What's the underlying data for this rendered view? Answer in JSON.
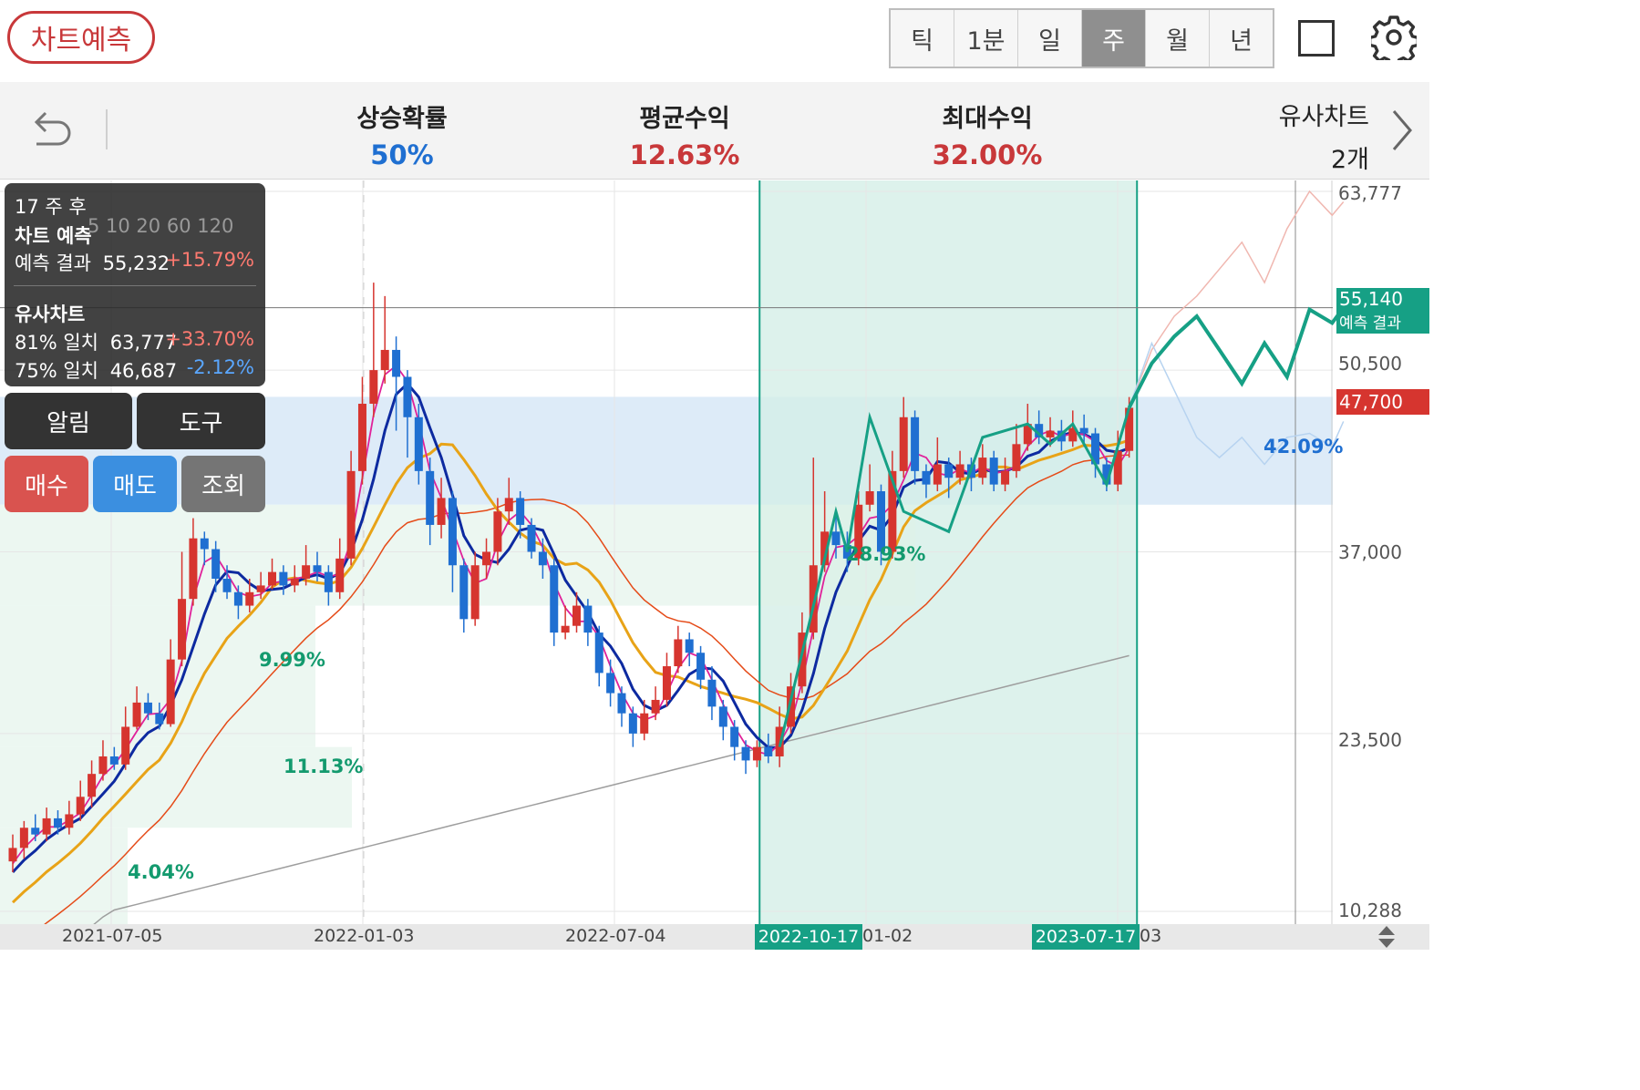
{
  "header": {
    "predict_button": "차트예측",
    "periods": [
      {
        "label": "틱",
        "selected": false
      },
      {
        "label": "1분",
        "selected": false
      },
      {
        "label": "일",
        "selected": false
      },
      {
        "label": "주",
        "selected": true
      },
      {
        "label": "월",
        "selected": false
      },
      {
        "label": "년",
        "selected": false
      }
    ],
    "icons": [
      "square-icon",
      "gear-icon"
    ]
  },
  "stats": {
    "rise_prob": {
      "label": "상승확률",
      "value": "50%"
    },
    "avg_return": {
      "label": "평균수익",
      "value": "12.63%"
    },
    "max_return": {
      "label": "최대수익",
      "value": "32.00%"
    },
    "similar": {
      "label": "유사차트",
      "value": "2개"
    }
  },
  "colors": {
    "up": "#d6352f",
    "down": "#1f6fd1",
    "accent_green": "#16a085",
    "ma5": "#e0219a",
    "ma10": "#0d2aa0",
    "ma20": "#e8a317",
    "ma60": "#e54b18",
    "ma120": "#9e9e9e"
  },
  "overlay": {
    "weeks_after": "17 주 후",
    "predict_title": "차트 예측",
    "predict_label": "예측 결과",
    "predict_value": "55,232",
    "predict_change": "+15.79%",
    "similar_title": "유사차트",
    "sim1_label": "81% 일치",
    "sim1_value": "63,777",
    "sim1_change": "+33.70%",
    "sim2_label": "75% 일치",
    "sim2_value": "46,687",
    "sim2_change": "-2.12%",
    "legend_partial": "5  10  20  60  120"
  },
  "actions": {
    "alert": "알림",
    "tools": "도구",
    "buy": "매수",
    "sell": "매도",
    "lookup": "조회"
  },
  "chart_data": {
    "type": "candlestick",
    "period": "weekly",
    "y_ticks": [
      "63,777",
      "50,500",
      "37,000",
      "23,500",
      "10,288"
    ],
    "y_tick_values": [
      63777,
      50500,
      37000,
      23500,
      10288
    ],
    "x_ticks": [
      "2021-07-05",
      "2022-01-03",
      "2022-07-04",
      "01-02",
      "03"
    ],
    "x_tick_values": [
      "2021-07-05",
      "2022-01-03",
      "2022-07-04",
      "2023-01-02",
      "2023-07-03"
    ],
    "highlight_start": "2022-10-17",
    "highlight_end": "2023-07-17",
    "current_price": "47,700",
    "current_price_value": 47700,
    "predict_label": "55,140",
    "predict_label_value": 55140,
    "predict_tag": "예측 결과",
    "zone_pct_right": "42.09%",
    "region_pcts": [
      "9.99%",
      "11.13%",
      "4.04%",
      "28.93%"
    ],
    "candles": [
      [
        0,
        14000,
        15000,
        16000,
        13200
      ],
      [
        1,
        15000,
        16500,
        17000,
        14200
      ],
      [
        2,
        16500,
        16000,
        17500,
        15500
      ],
      [
        3,
        16000,
        17200,
        18000,
        15500
      ],
      [
        4,
        17200,
        16500,
        17800,
        16000
      ],
      [
        5,
        16500,
        17500,
        18500,
        16000
      ],
      [
        6,
        17500,
        18800,
        20000,
        17000
      ],
      [
        7,
        18800,
        20500,
        21500,
        18000
      ],
      [
        8,
        20500,
        21800,
        23000,
        20000
      ],
      [
        9,
        21800,
        21200,
        22500,
        20800
      ],
      [
        10,
        21200,
        24000,
        25500,
        20800
      ],
      [
        11,
        24000,
        25800,
        27000,
        23800
      ],
      [
        12,
        25800,
        25000,
        26500,
        24500
      ],
      [
        13,
        25000,
        24200,
        25800,
        23800
      ],
      [
        14,
        24200,
        29000,
        30500,
        24000
      ],
      [
        15,
        29000,
        33500,
        37000,
        28500
      ],
      [
        16,
        33500,
        38000,
        39500,
        33000
      ],
      [
        17,
        38000,
        37200,
        38500,
        36000
      ],
      [
        18,
        37200,
        35000,
        37800,
        34000
      ],
      [
        19,
        35000,
        34000,
        36000,
        33500
      ],
      [
        20,
        34000,
        33000,
        34500,
        32000
      ],
      [
        21,
        33000,
        34000,
        35000,
        32500
      ],
      [
        22,
        34000,
        34500,
        35500,
        33500
      ],
      [
        23,
        34500,
        35500,
        36500,
        34200
      ],
      [
        24,
        35500,
        34500,
        36000,
        33800
      ],
      [
        25,
        34500,
        35000,
        36000,
        34000
      ],
      [
        26,
        35000,
        36000,
        37500,
        34500
      ],
      [
        27,
        36000,
        35500,
        37000,
        34800
      ],
      [
        28,
        35500,
        34000,
        36000,
        33000
      ],
      [
        29,
        34000,
        36500,
        38000,
        33500
      ],
      [
        30,
        36500,
        43000,
        44500,
        36000
      ],
      [
        31,
        43000,
        48000,
        50000,
        42000
      ],
      [
        32,
        48000,
        50500,
        57000,
        47000
      ],
      [
        33,
        50500,
        52000,
        56000,
        49500
      ],
      [
        34,
        52000,
        50000,
        53000,
        46000
      ],
      [
        35,
        50000,
        47000,
        50500,
        44000
      ],
      [
        36,
        47000,
        43000,
        48000,
        42000
      ],
      [
        37,
        43000,
        39000,
        44000,
        37500
      ],
      [
        38,
        39000,
        41000,
        42500,
        38000
      ],
      [
        39,
        41000,
        36000,
        41500,
        34000
      ],
      [
        40,
        36000,
        32000,
        36500,
        31000
      ],
      [
        41,
        32000,
        36000,
        37000,
        31500
      ],
      [
        42,
        36000,
        37000,
        38000,
        35000
      ],
      [
        43,
        37000,
        40000,
        41000,
        36000
      ],
      [
        44,
        40000,
        41000,
        42500,
        39000
      ],
      [
        45,
        41000,
        39000,
        41500,
        38000
      ],
      [
        46,
        39000,
        37000,
        39500,
        36500
      ],
      [
        47,
        37000,
        36000,
        38000,
        35000
      ],
      [
        48,
        36000,
        31000,
        36500,
        30000
      ],
      [
        49,
        31000,
        31500,
        33000,
        30500
      ],
      [
        50,
        31500,
        33000,
        34000,
        31000
      ],
      [
        51,
        33000,
        31000,
        33500,
        30000
      ],
      [
        52,
        31000,
        28000,
        31500,
        27000
      ],
      [
        53,
        28000,
        26500,
        29000,
        25500
      ],
      [
        54,
        26500,
        25000,
        27000,
        24000
      ],
      [
        55,
        25000,
        23500,
        25500,
        22500
      ],
      [
        56,
        23500,
        25000,
        26000,
        23000
      ],
      [
        57,
        25000,
        26000,
        27000,
        24500
      ],
      [
        58,
        26000,
        28500,
        29500,
        25500
      ],
      [
        59,
        28500,
        30500,
        31500,
        28000
      ],
      [
        60,
        30500,
        29500,
        31000,
        28500
      ],
      [
        61,
        29500,
        27500,
        30000,
        26800
      ],
      [
        62,
        27500,
        25500,
        28500,
        24500
      ],
      [
        63,
        25500,
        24000,
        26000,
        23000
      ],
      [
        64,
        24000,
        22500,
        24500,
        21500
      ],
      [
        65,
        22500,
        21500,
        23000,
        20500
      ],
      [
        66,
        21500,
        22500,
        23000,
        21000
      ],
      [
        67,
        22500,
        21800,
        23500,
        21300
      ],
      [
        68,
        21800,
        24000,
        25500,
        21000
      ],
      [
        69,
        24000,
        27000,
        28000,
        23500
      ],
      [
        70,
        27000,
        31000,
        32500,
        26500
      ],
      [
        71,
        31000,
        36000,
        44000,
        30500
      ],
      [
        72,
        36000,
        38500,
        41500,
        35500
      ],
      [
        73,
        38500,
        37500,
        40000,
        36500
      ],
      [
        74,
        37500,
        36500,
        38500,
        35500
      ],
      [
        75,
        36500,
        40500,
        41500,
        36000
      ],
      [
        76,
        40500,
        41500,
        43500,
        40000
      ],
      [
        77,
        41500,
        37000,
        42000,
        36000
      ],
      [
        78,
        37000,
        43000,
        44500,
        36500
      ],
      [
        79,
        43000,
        47000,
        48500,
        42500
      ],
      [
        80,
        47000,
        43000,
        47500,
        42000
      ],
      [
        81,
        43000,
        42000,
        43500,
        41000
      ],
      [
        82,
        42000,
        43500,
        45500,
        41500
      ],
      [
        83,
        43500,
        42500,
        44000,
        41000
      ],
      [
        84,
        42500,
        43500,
        44500,
        42000
      ],
      [
        85,
        43500,
        42500,
        44000,
        41500
      ],
      [
        86,
        42500,
        44000,
        45000,
        42000
      ],
      [
        87,
        44000,
        42000,
        44500,
        41500
      ],
      [
        88,
        42000,
        43000,
        44000,
        41500
      ],
      [
        89,
        43000,
        45000,
        46500,
        42500
      ],
      [
        90,
        45000,
        46500,
        48000,
        44500
      ],
      [
        91,
        46500,
        45500,
        47500,
        45000
      ],
      [
        92,
        45500,
        46000,
        47000,
        44800
      ],
      [
        93,
        46000,
        45200,
        46800,
        44500
      ],
      [
        94,
        45200,
        46200,
        47500,
        44800
      ],
      [
        95,
        46200,
        45800,
        47200,
        44800
      ],
      [
        96,
        45800,
        43500,
        46200,
        42500
      ],
      [
        97,
        43500,
        42000,
        44000,
        41500
      ],
      [
        98,
        42000,
        44500,
        46000,
        41500
      ],
      [
        99,
        44500,
        47700,
        48500,
        44000
      ]
    ],
    "prediction_path": [
      [
        99,
        47700
      ],
      [
        101,
        51000
      ],
      [
        103,
        53000
      ],
      [
        105,
        54500
      ],
      [
        107,
        52000
      ],
      [
        109,
        49500
      ],
      [
        111,
        52500
      ],
      [
        113,
        50000
      ],
      [
        115,
        55000
      ],
      [
        117,
        54000
      ],
      [
        118,
        55140
      ]
    ],
    "similar_paths": [
      {
        "name": "81% 일치",
        "points": [
          [
            99,
            47700
          ],
          [
            101,
            52000
          ],
          [
            103,
            54500
          ],
          [
            105,
            56000
          ],
          [
            107,
            58000
          ],
          [
            109,
            60000
          ],
          [
            111,
            57000
          ],
          [
            113,
            61000
          ],
          [
            115,
            63777
          ],
          [
            117,
            62000
          ],
          [
            118,
            63000
          ]
        ]
      },
      {
        "name": "75% 일치",
        "points": [
          [
            99,
            47700
          ],
          [
            101,
            52500
          ],
          [
            103,
            49000
          ],
          [
            105,
            45500
          ],
          [
            107,
            44000
          ],
          [
            109,
            45500
          ],
          [
            111,
            43500
          ],
          [
            113,
            45500
          ],
          [
            115,
            45800
          ],
          [
            117,
            44800
          ],
          [
            118,
            46687
          ]
        ]
      }
    ]
  }
}
